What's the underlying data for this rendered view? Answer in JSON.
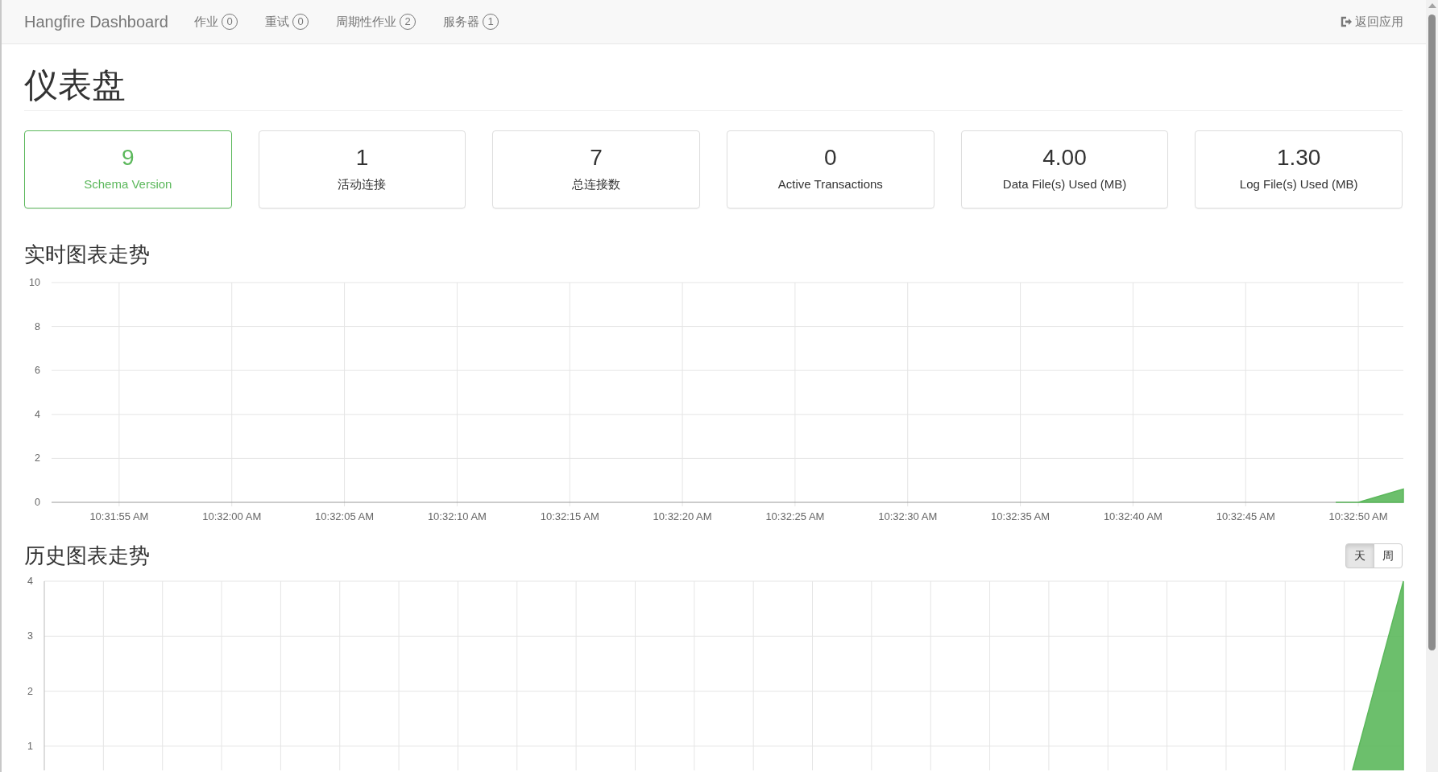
{
  "navbar": {
    "brand": "Hangfire Dashboard",
    "items": [
      {
        "label": "作业",
        "count": "0"
      },
      {
        "label": "重试",
        "count": "0"
      },
      {
        "label": "周期性作业",
        "count": "2"
      },
      {
        "label": "服务器",
        "count": "1"
      }
    ],
    "back_link": "返回应用"
  },
  "page_title": "仪表盘",
  "metrics": [
    {
      "value": "9",
      "label": "Schema Version",
      "kind": "success"
    },
    {
      "value": "1",
      "label": "活动连接",
      "kind": "default"
    },
    {
      "value": "7",
      "label": "总连接数",
      "kind": "default"
    },
    {
      "value": "0",
      "label": "Active Transactions",
      "kind": "default"
    },
    {
      "value": "4.00",
      "label": "Data File(s) Used (MB)",
      "kind": "default"
    },
    {
      "value": "1.30",
      "label": "Log File(s) Used (MB)",
      "kind": "default"
    }
  ],
  "realtime": {
    "title": "实时图表走势",
    "chart_data": {
      "type": "area",
      "grid": true,
      "ylim": [
        0,
        10
      ],
      "categories": [
        null,
        null,
        null,
        "10:31:55 AM",
        null,
        null,
        null,
        null,
        "10:32:00 AM",
        null,
        null,
        null,
        null,
        "10:32:05 AM",
        null,
        null,
        null,
        null,
        "10:32:10 AM",
        null,
        null,
        null,
        null,
        "10:32:15 AM",
        null,
        null,
        null,
        null,
        "10:32:20 AM",
        null,
        null,
        null,
        null,
        "10:32:25 AM",
        null,
        null,
        null,
        null,
        "10:32:30 AM",
        null,
        null,
        null,
        null,
        "10:32:35 AM",
        null,
        null,
        null,
        null,
        "10:32:40 AM",
        null,
        null,
        null,
        null,
        "10:32:45 AM",
        null,
        null,
        null,
        null,
        "10:32:50 AM",
        null,
        null
      ],
      "series": [
        {
          "color": "#5cb85c",
          "values": [
            null,
            null,
            null,
            null,
            null,
            null,
            null,
            null,
            null,
            null,
            null,
            null,
            null,
            null,
            null,
            null,
            null,
            null,
            null,
            null,
            null,
            null,
            null,
            null,
            null,
            null,
            null,
            null,
            null,
            null,
            null,
            null,
            null,
            null,
            null,
            null,
            null,
            null,
            null,
            null,
            null,
            null,
            null,
            null,
            null,
            null,
            null,
            null,
            null,
            null,
            null,
            null,
            null,
            null,
            null,
            null,
            null,
            0,
            0,
            0.3,
            0.6
          ]
        }
      ],
      "yticks": [
        0,
        2,
        4,
        6,
        8,
        10
      ]
    }
  },
  "history": {
    "title": "历史图表走势",
    "periods": [
      {
        "label": "天",
        "selected": true
      },
      {
        "label": "周",
        "selected": false
      }
    ],
    "chart_data": {
      "type": "area",
      "grid": true,
      "ylim": [
        0,
        4
      ],
      "yticks": [
        1,
        2,
        3,
        4
      ],
      "series": [
        {
          "color": "#5cb85c",
          "values": [
            0,
            0,
            0,
            0,
            0,
            0,
            0,
            0,
            0,
            0,
            0,
            0,
            0,
            0,
            0,
            0,
            0,
            0,
            0,
            0,
            0,
            0,
            0,
            4
          ]
        }
      ]
    }
  }
}
